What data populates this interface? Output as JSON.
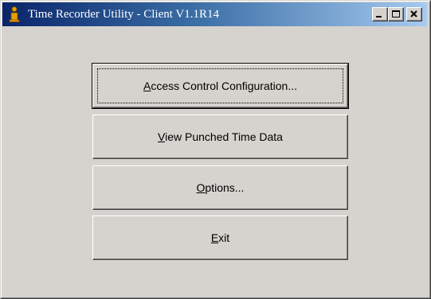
{
  "window": {
    "title": "Time Recorder Utility - Client V1.1R14",
    "app_icon": "info-person-icon",
    "controls": {
      "minimize_icon": "minimize-icon",
      "maximize_icon": "maximize-icon",
      "close_icon": "close-icon"
    }
  },
  "buttons": [
    {
      "mnemonic": "A",
      "rest": "ccess Control Configuration...",
      "focused": true
    },
    {
      "mnemonic": "V",
      "rest": "iew Punched Time Data",
      "focused": false
    },
    {
      "mnemonic": "O",
      "rest": "ptions...",
      "focused": false
    },
    {
      "mnemonic": "E",
      "rest": "xit",
      "focused": false
    }
  ],
  "colors": {
    "face": "#d6d3ce",
    "title_start": "#0a246a",
    "title_end": "#a6caf0"
  }
}
